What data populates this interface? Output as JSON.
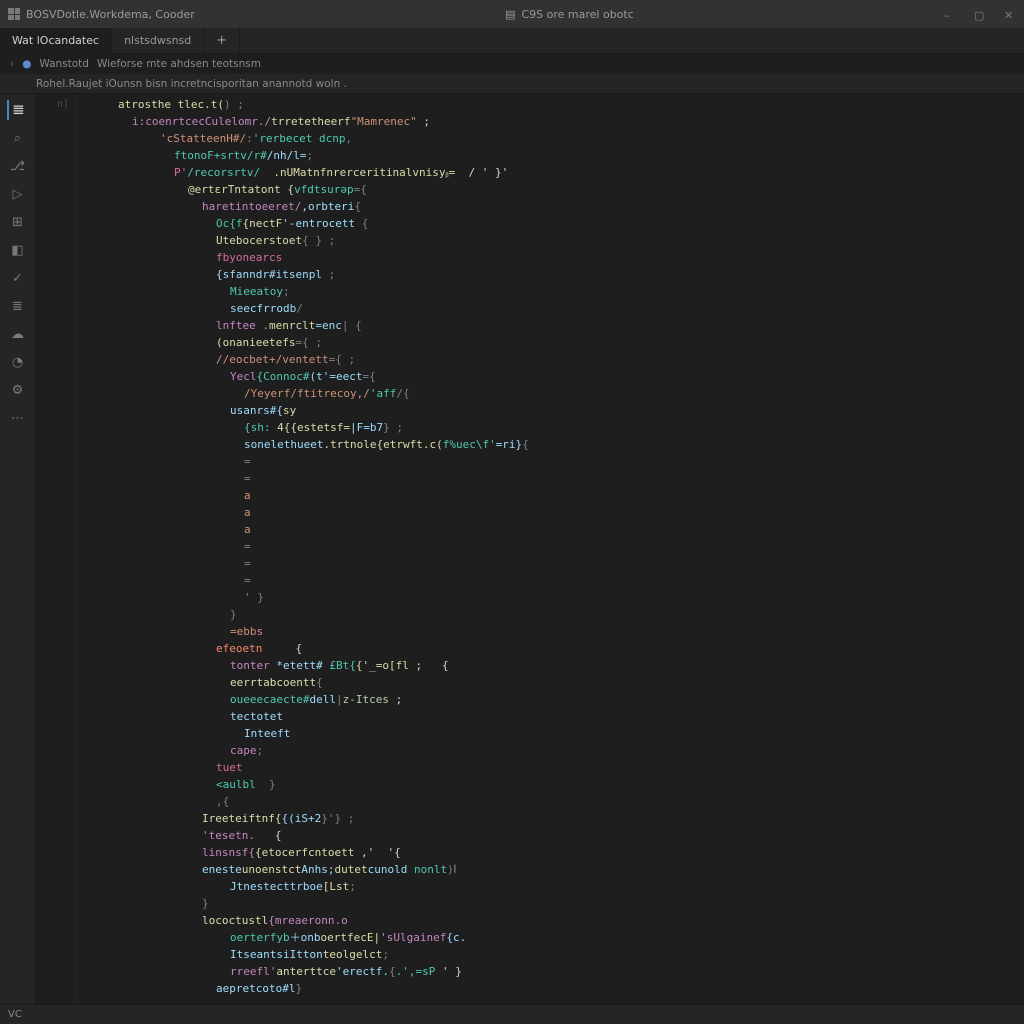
{
  "titlebar": {
    "left_label": "BOSVDotle.Workdema, Cooder",
    "center_prefix_icon": "file-icon",
    "center_label": "C9S ore marel obotc",
    "ctrl_min": "–",
    "ctrl_max": "▢",
    "ctrl_close": "✕"
  },
  "tabs": [
    {
      "label": "Wat lOcandatec",
      "active": true
    },
    {
      "label": "nlstsdwsnsd",
      "active": false
    }
  ],
  "tab_add": "+",
  "breadcrumb": {
    "arrow_icon": "›",
    "dot_icon": "●",
    "segment1": "Wanstotd",
    "segment2": "Wieforse mte ahdsen teotsnsm"
  },
  "secbar": {
    "left": "Rohel.Raujet iOunsn bisn incretncisporitan anannotd woln ."
  },
  "activity_icons": [
    {
      "name": "files-icon",
      "glyph": "𝌆",
      "sel": true
    },
    {
      "name": "search-icon",
      "glyph": "⌕"
    },
    {
      "name": "scm-icon",
      "glyph": "⎇"
    },
    {
      "name": "debug-icon",
      "glyph": "▷"
    },
    {
      "name": "extensions-icon",
      "glyph": "⊞"
    },
    {
      "name": "remote-icon",
      "glyph": "◧"
    },
    {
      "name": "test-icon",
      "glyph": "✓"
    },
    {
      "name": "db-icon",
      "glyph": "≣"
    },
    {
      "name": "cloud-icon",
      "glyph": "☁"
    },
    {
      "name": "account-icon",
      "glyph": "◔"
    },
    {
      "name": "settings-icon",
      "glyph": "⚙"
    },
    {
      "name": "more-icon",
      "glyph": "⋯"
    }
  ],
  "gutter_first_line": "n]",
  "code": [
    {
      "i": 3,
      "t": [
        [
          "fn",
          "atrosthe tlec.t("
        ],
        [
          "pun",
          ") ;"
        ]
      ]
    },
    {
      "i": 4,
      "t": [
        [
          "kw",
          "i:coenrtcecCulelomr./"
        ],
        [
          "fn",
          "trretetheerf"
        ],
        [
          "str",
          "\"Mamrenec\""
        ],
        [
          "op",
          " ;"
        ]
      ]
    },
    {
      "i": 6,
      "t": [
        [
          "str",
          "'cStatteenH#/"
        ],
        [
          "pun",
          ":"
        ],
        [
          "type",
          "'rerbecet\tdcnp"
        ],
        [
          "pun",
          ","
        ]
      ]
    },
    {
      "i": 7,
      "t": [
        [
          "type",
          "ftonoF+srtv/r#"
        ],
        [
          "var",
          "/nh/l="
        ],
        [
          "pun",
          ";"
        ]
      ]
    },
    {
      "i": 7,
      "t": [
        [
          "pink",
          "P'"
        ],
        [
          "type",
          "/recorsrtv/"
        ],
        [
          "fn",
          "  .nUMatnfnrerceritinalvnisyᵦ="
        ],
        [
          "op",
          "  / ' }'"
        ]
      ]
    },
    {
      "i": 8,
      "t": [
        [
          "fn",
          "@ertɛrTntatont {"
        ],
        [
          "type",
          "vfdtsurǝp"
        ],
        [
          "pun",
          "={"
        ]
      ]
    },
    {
      "i": 9,
      "t": [
        [
          "kw",
          "haretintoeeret/"
        ],
        [
          "var",
          ",orbteri"
        ],
        [
          "pun",
          "{"
        ]
      ]
    },
    {
      "i": 10,
      "t": [
        [
          "type",
          "Oc{f"
        ],
        [
          "fn",
          "{nectF"
        ],
        [
          "var",
          "'-entrocett"
        ],
        [
          "pun",
          " {"
        ]
      ]
    },
    {
      "i": 10,
      "t": [
        [
          "fn",
          "Utebocerstoet"
        ],
        [
          "pun",
          "{ } ;"
        ]
      ]
    },
    {
      "i": 10,
      "t": [
        [
          "pink",
          "fbyonearcs"
        ]
      ]
    },
    {
      "i": 10,
      "t": [
        [
          "var",
          "{sfanndr#itsenpl"
        ],
        [
          "pun",
          " ;"
        ]
      ]
    },
    {
      "i": 11,
      "t": [
        [
          "type",
          "Mieeatoy"
        ],
        [
          "pun",
          ";"
        ]
      ]
    },
    {
      "i": 11,
      "t": [
        [
          "var",
          "seecfrrodb"
        ],
        [
          "pun",
          "/"
        ]
      ]
    },
    {
      "i": 10,
      "t": [
        [
          "kw",
          "lnftee ."
        ],
        [
          "fn",
          "menrclt"
        ],
        [
          "var",
          "=enc"
        ],
        [
          "pun",
          "| {"
        ]
      ]
    },
    {
      "i": 10,
      "t": [
        [
          "fn",
          "(onanieetefs"
        ],
        [
          "pun",
          "={ ;"
        ]
      ]
    },
    {
      "i": 10,
      "t": [
        [
          "str",
          "//eocbet+/ventett"
        ],
        [
          "pun",
          "={ ;"
        ]
      ]
    },
    {
      "i": 11,
      "t": [
        [
          "kw",
          "Yecl"
        ],
        [
          "type",
          "{Connoc#"
        ],
        [
          "var",
          "(t'=eect"
        ],
        [
          "pun",
          "={"
        ]
      ]
    },
    {
      "i": 12,
      "t": [
        [
          "str",
          "/Yeyerf/ftitrecoy,/"
        ],
        [
          "type",
          "'aff"
        ],
        [
          "pun",
          "/{"
        ]
      ]
    },
    {
      "i": 11,
      "t": [
        [
          "var",
          "usanrs#{"
        ],
        [
          "fn",
          "sy"
        ]
      ]
    },
    {
      "i": 12,
      "t": [
        [
          "type",
          "{sh: "
        ],
        [
          "fn",
          "4{{estetsf="
        ],
        [
          "var",
          "|F=b7"
        ],
        [
          "pun",
          "} ;"
        ]
      ]
    },
    {
      "i": 12,
      "t": [
        [
          "var",
          "sonelethueet"
        ],
        [
          "fn",
          ".trtnole{etrwft.c("
        ],
        [
          "type",
          "f%uec\\f'"
        ],
        [
          "var",
          "=ri}"
        ],
        [
          "pun",
          "{"
        ]
      ]
    },
    {
      "i": 12,
      "t": [
        [
          "pun",
          "="
        ]
      ]
    },
    {
      "i": 12,
      "t": [
        [
          "pun",
          "="
        ]
      ]
    },
    {
      "i": 12,
      "t": [
        [
          "str",
          "a"
        ]
      ]
    },
    {
      "i": 12,
      "t": [
        [
          "str",
          "a"
        ]
      ]
    },
    {
      "i": 12,
      "t": [
        [
          "str",
          "a"
        ]
      ]
    },
    {
      "i": 12,
      "t": [
        [
          "pun",
          "="
        ]
      ]
    },
    {
      "i": 12,
      "t": [
        [
          "pun",
          "="
        ]
      ]
    },
    {
      "i": 12,
      "t": [
        [
          "pun",
          "="
        ]
      ]
    },
    {
      "i": 12,
      "t": [
        [
          "pun",
          "' }"
        ]
      ]
    },
    {
      "i": 11,
      "t": [
        [
          "pun",
          "}"
        ]
      ]
    },
    {
      "i": 11,
      "t": [
        [
          "str",
          "=ebbs"
        ]
      ]
    },
    {
      "i": 10,
      "t": [
        [
          "red",
          "efeoetn"
        ],
        [
          "op",
          "     {"
        ]
      ]
    },
    {
      "i": 11,
      "t": [
        [
          "kw",
          "tonter "
        ],
        [
          "var",
          "*etett# "
        ],
        [
          "type",
          "£Bt{"
        ],
        [
          "fn",
          "{'_=o[fl"
        ],
        [
          "op",
          " ;   {"
        ]
      ]
    },
    {
      "i": 11,
      "t": [
        [
          "fn",
          "eerrtabcoentt"
        ],
        [
          "pun",
          "{"
        ]
      ]
    },
    {
      "i": 11,
      "t": [
        [
          "type",
          "oueeecaecte#"
        ],
        [
          "var",
          "dell"
        ],
        [
          "pun",
          "|"
        ],
        [
          "num",
          "z-Itces"
        ],
        [
          "op",
          " ;"
        ]
      ]
    },
    {
      "i": 11,
      "t": [
        [
          "var",
          "tectotet"
        ]
      ]
    },
    {
      "i": 12,
      "t": [
        [
          "var",
          "Inteeft"
        ]
      ]
    },
    {
      "i": 11,
      "t": [
        [
          "kw",
          "cape"
        ],
        [
          "pun",
          ";"
        ]
      ]
    },
    {
      "i": 10,
      "t": [
        [
          "pink",
          "tuet"
        ]
      ]
    },
    {
      "i": 10,
      "t": [
        [
          "type",
          "<aulbl "
        ],
        [
          "pun",
          " }"
        ]
      ]
    },
    {
      "i": 10,
      "t": [
        [
          "pun",
          ",{"
        ]
      ]
    },
    {
      "i": 9,
      "t": [
        [
          "fn",
          "Ireeteiftnf{"
        ],
        [
          "var",
          "{(iS+2"
        ],
        [
          "pun",
          "}'} ;"
        ]
      ]
    },
    {
      "i": 9,
      "t": [
        [
          "kw",
          "'tesetn."
        ],
        [
          "op",
          "   {"
        ]
      ]
    },
    {
      "i": 9,
      "t": [
        [
          "kw",
          "linsnsf{"
        ],
        [
          "fn",
          "{etocerfcntoett"
        ],
        [
          "op",
          " ,'  '{"
        ]
      ]
    },
    {
      "i": 9,
      "t": [
        [
          "var",
          "eneste"
        ],
        [
          "fn",
          "unoenstct"
        ],
        [
          "var",
          "Anhs;"
        ],
        [
          "fn",
          "dutet"
        ],
        [
          "var",
          "cunold "
        ],
        [
          "type",
          "nonlt"
        ],
        [
          "pun",
          ")"
        ],
        [
          "op",
          "⦚"
        ]
      ]
    },
    {
      "i": 11,
      "t": [
        [
          "var",
          "Jtnestecttrboe"
        ],
        [
          "fn",
          "[Lst"
        ],
        [
          "pun",
          ";"
        ]
      ]
    },
    {
      "i": 9,
      "t": [
        [
          "pun",
          "}"
        ]
      ]
    },
    {
      "i": 9,
      "t": [
        [
          "fn",
          "lococtustl"
        ],
        [
          "kw",
          "{mreaeronn.o"
        ]
      ]
    },
    {
      "i": 11,
      "t": [
        [
          "type",
          "oerterfyb"
        ],
        [
          "var",
          "＋onb"
        ],
        [
          "fn",
          "oertfecE|"
        ],
        [
          "kw",
          "'sUlgainef"
        ],
        [
          "var",
          "{c."
        ]
      ]
    },
    {
      "i": 11,
      "t": [
        [
          "var",
          "ItseantsiItton"
        ],
        [
          "fn",
          "teolgelct"
        ],
        [
          "pun",
          ";"
        ]
      ]
    },
    {
      "i": 11,
      "t": [
        [
          "kw",
          "rreefl'"
        ],
        [
          "fn",
          "anterttce"
        ],
        [
          "var",
          "'erectf."
        ],
        [
          "pun",
          "{"
        ],
        [
          "type",
          ".',=sP"
        ],
        [
          "op",
          " ' }"
        ]
      ]
    },
    {
      "i": 10,
      "t": [
        [
          "var",
          "aepretcoto#l"
        ],
        [
          "pun",
          "}"
        ]
      ]
    }
  ],
  "statusbar": {
    "left": "VC"
  }
}
